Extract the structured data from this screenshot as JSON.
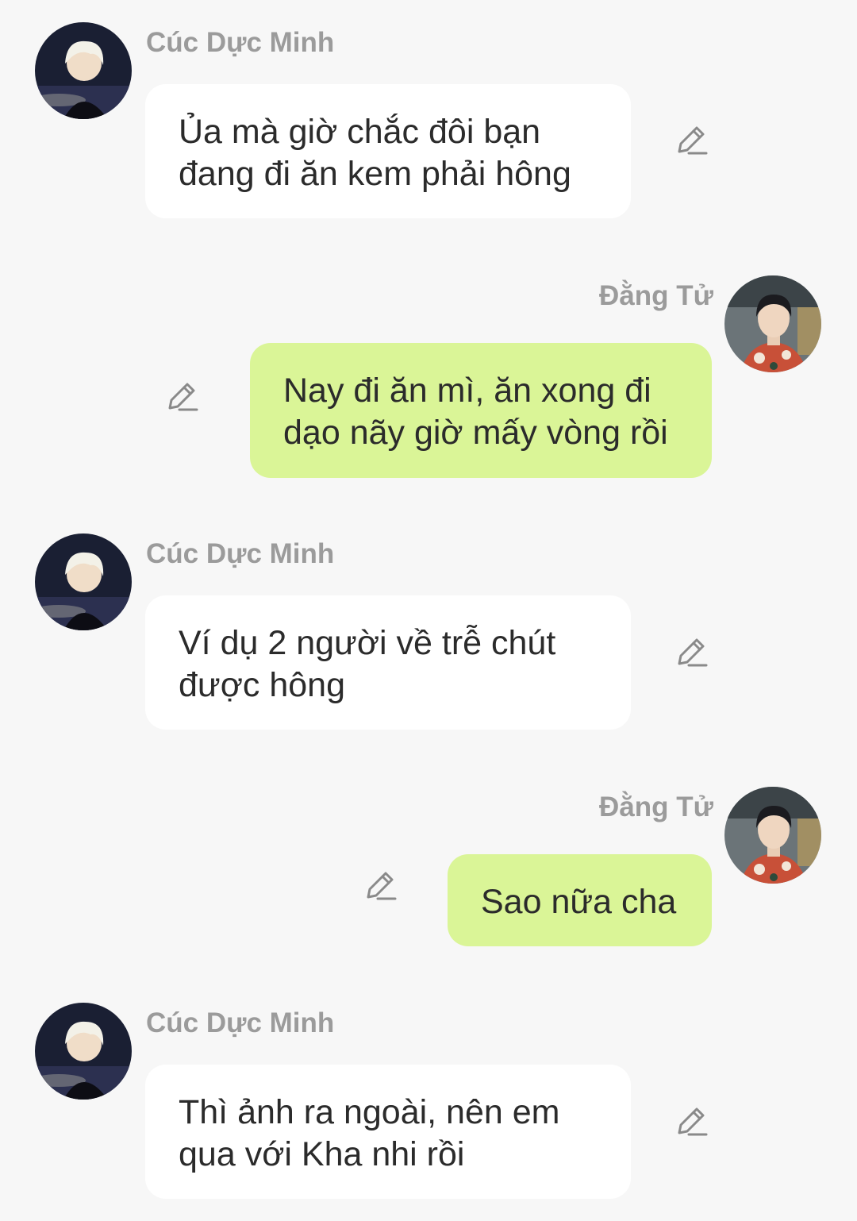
{
  "colors": {
    "background": "#f7f7f7",
    "incoming_bubble": "#ffffff",
    "outgoing_bubble": "#daf597",
    "name_text": "#9b9b9b",
    "message_text": "#2b2b2b",
    "edit_icon": "#8a8a8a"
  },
  "messages": [
    {
      "direction": "incoming",
      "sender": "Cúc Dực Minh",
      "avatar": "avatar-cuc-duc-minh",
      "lines": [
        "Ủa mà giờ chắc đôi bạn",
        "đang đi ăn kem phải hông"
      ],
      "icon": "pencil-edit-icon"
    },
    {
      "direction": "outgoing",
      "sender": "Đằng Tử",
      "avatar": "avatar-dang-tu",
      "lines": [
        "Nay đi ăn mì, ăn xong đi",
        "dạo nãy giờ mấy vòng rồi"
      ],
      "icon": "pencil-edit-icon"
    },
    {
      "direction": "incoming",
      "sender": "Cúc Dực Minh",
      "avatar": "avatar-cuc-duc-minh",
      "lines": [
        "Ví dụ 2 người về trễ chút",
        "được hông"
      ],
      "icon": "pencil-edit-icon"
    },
    {
      "direction": "outgoing",
      "sender": "Đằng Tử",
      "avatar": "avatar-dang-tu",
      "lines": [
        "Sao nữa cha"
      ],
      "icon": "pencil-edit-icon"
    },
    {
      "direction": "incoming",
      "sender": "Cúc Dực Minh",
      "avatar": "avatar-cuc-duc-minh",
      "lines": [
        "Thì ảnh ra ngoài, nên em",
        "qua với Kha nhi rồi"
      ],
      "icon": "pencil-edit-icon"
    }
  ]
}
